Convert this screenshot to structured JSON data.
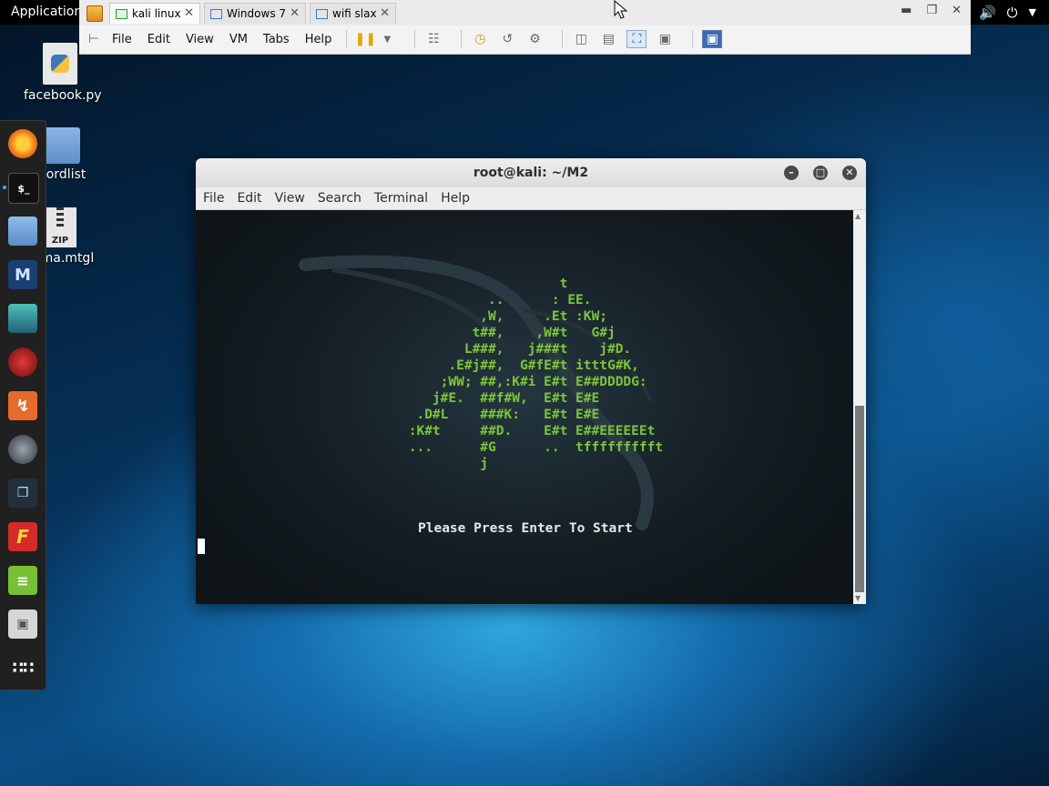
{
  "top_panel": {
    "apps_label": "Applications"
  },
  "vmware": {
    "tabs": [
      {
        "label": "kali linux",
        "active": true
      },
      {
        "label": "Windows 7",
        "active": false
      },
      {
        "label": "wifi slax",
        "active": false
      }
    ],
    "menu": [
      "File",
      "Edit",
      "View",
      "VM",
      "Tabs",
      "Help"
    ]
  },
  "desktop": {
    "icons": [
      {
        "label": "facebook.py",
        "icon": "python-file-icon"
      },
      {
        "label": "Wordlist",
        "icon": "folder-icon"
      },
      {
        "label": "sama.mtgl",
        "icon": "zip-file-icon",
        "badge": "ZIP"
      }
    ]
  },
  "dock": {
    "items": [
      {
        "name": "firefox",
        "icon": "firefox-icon",
        "color": "#f2761c"
      },
      {
        "name": "terminal",
        "icon": "terminal-icon",
        "color": "#1b1b1b",
        "glyph": "$_"
      },
      {
        "name": "files",
        "icon": "files-icon",
        "color": "#6aa2d8"
      },
      {
        "name": "metasploit",
        "icon": "metasploit-icon",
        "color": "#1a6fb5"
      },
      {
        "name": "armitage",
        "icon": "armitage-icon",
        "color": "#3aa9a2"
      },
      {
        "name": "beef",
        "icon": "beef-icon",
        "color": "#b01b1b"
      },
      {
        "name": "burpsuite",
        "icon": "burpsuite-icon",
        "color": "#e56a2b"
      },
      {
        "name": "maltego",
        "icon": "maltego-icon",
        "color": "#2f3640"
      },
      {
        "name": "sqlmap",
        "icon": "sqlmap-icon",
        "color": "#1f2a33"
      },
      {
        "name": "faraday",
        "icon": "faraday-icon",
        "color": "#d12b2b"
      },
      {
        "name": "leafpad",
        "icon": "text-editor-icon",
        "color": "#79c034"
      },
      {
        "name": "screenshot",
        "icon": "screenshot-icon",
        "color": "#d8d8d8"
      },
      {
        "name": "show-apps",
        "icon": "app-grid-icon",
        "color": "#202020"
      }
    ]
  },
  "terminal": {
    "title": "root@kali: ~/M2",
    "menu": [
      "File",
      "Edit",
      "View",
      "Search",
      "Terminal",
      "Help"
    ],
    "art_lines": [
      "                    t",
      "           ..      : EE.",
      "          ,W,     .Et :KW;",
      "         t##,    ,W#t   G#j",
      "        L###,   j###t    j#D.",
      "      .E#j##,  G#fE#t itttG#K,",
      "     ;WW; ##,:K#i E#t E##DDDDG:",
      "    j#E.  ##f#W,  E#t E#E",
      "  .D#L    ###K:   E#t E#E",
      " :K#t     ##D.    E#t E##EEEEEEt",
      " ...      #G      ..  tffffffffft",
      "          j"
    ],
    "prompt_text": "Please Press Enter To Start"
  }
}
